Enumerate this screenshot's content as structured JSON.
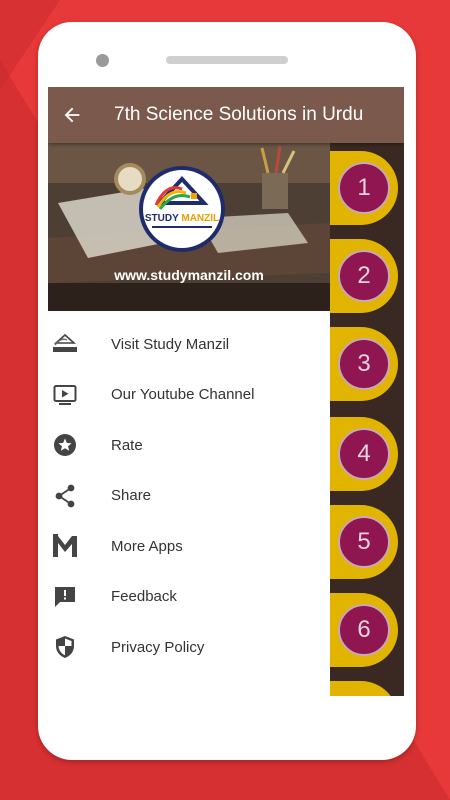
{
  "colors": {
    "background": "#e8393a",
    "app_bar": "#7b5a4d",
    "chapter_pill": "#e0b400",
    "chapter_circle": "#8f1650",
    "screen_bg": "#3a2922"
  },
  "app_bar": {
    "title": "7th Science Solutions in Urdu",
    "back_icon": "arrow-back-icon"
  },
  "drawer": {
    "header": {
      "logo_text": "STUDY MANZIL",
      "url": "www.studymanzil.com"
    },
    "items": [
      {
        "label": "Visit Study Manzil",
        "icon": "study-manzil-logo-icon"
      },
      {
        "label": "Our Youtube Channel",
        "icon": "youtube-icon"
      },
      {
        "label": "Rate",
        "icon": "star-icon"
      },
      {
        "label": "Share",
        "icon": "share-icon"
      },
      {
        "label": "More Apps",
        "icon": "more-apps-icon"
      },
      {
        "label": "Feedback",
        "icon": "feedback-icon"
      },
      {
        "label": "Privacy Policy",
        "icon": "shield-icon"
      }
    ]
  },
  "chapters": [
    "1",
    "2",
    "3",
    "4",
    "5",
    "6"
  ]
}
